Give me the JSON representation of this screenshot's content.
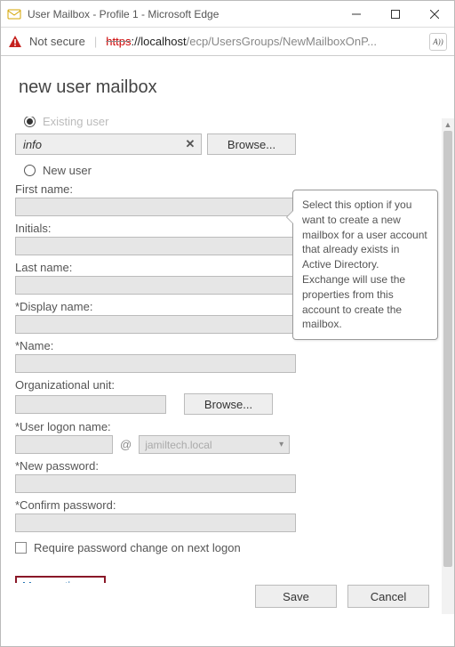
{
  "window": {
    "title": "User Mailbox - Profile 1 - Microsoft Edge"
  },
  "address": {
    "not_secure": "Not secure",
    "proto": "https",
    "host": "://localhost",
    "path": "/ecp/UsersGroups/NewMailboxOnP...",
    "reader_label": "A))"
  },
  "page": {
    "heading": "new user mailbox",
    "existing_user_label": "Existing user",
    "search_value": "info",
    "browse_label": "Browse...",
    "new_user_label": "New user",
    "labels": {
      "first_name": "First name:",
      "initials": "Initials:",
      "last_name": "Last name:",
      "display_name": "*Display name:",
      "name": "*Name:",
      "ou": "Organizational unit:",
      "logon": "*User logon name:",
      "new_password": "*New password:",
      "confirm_password": "*Confirm password:"
    },
    "at_sign": "@",
    "domain": "jamiltech.local",
    "require_pw_change": "Require password change on next logon",
    "more_options": "More options...",
    "tooltip": "Select this option if you want to create a new mailbox for a user account that already exists in Active Directory. Exchange will use the properties from this account to create the mailbox."
  },
  "footer": {
    "save": "Save",
    "cancel": "Cancel"
  }
}
